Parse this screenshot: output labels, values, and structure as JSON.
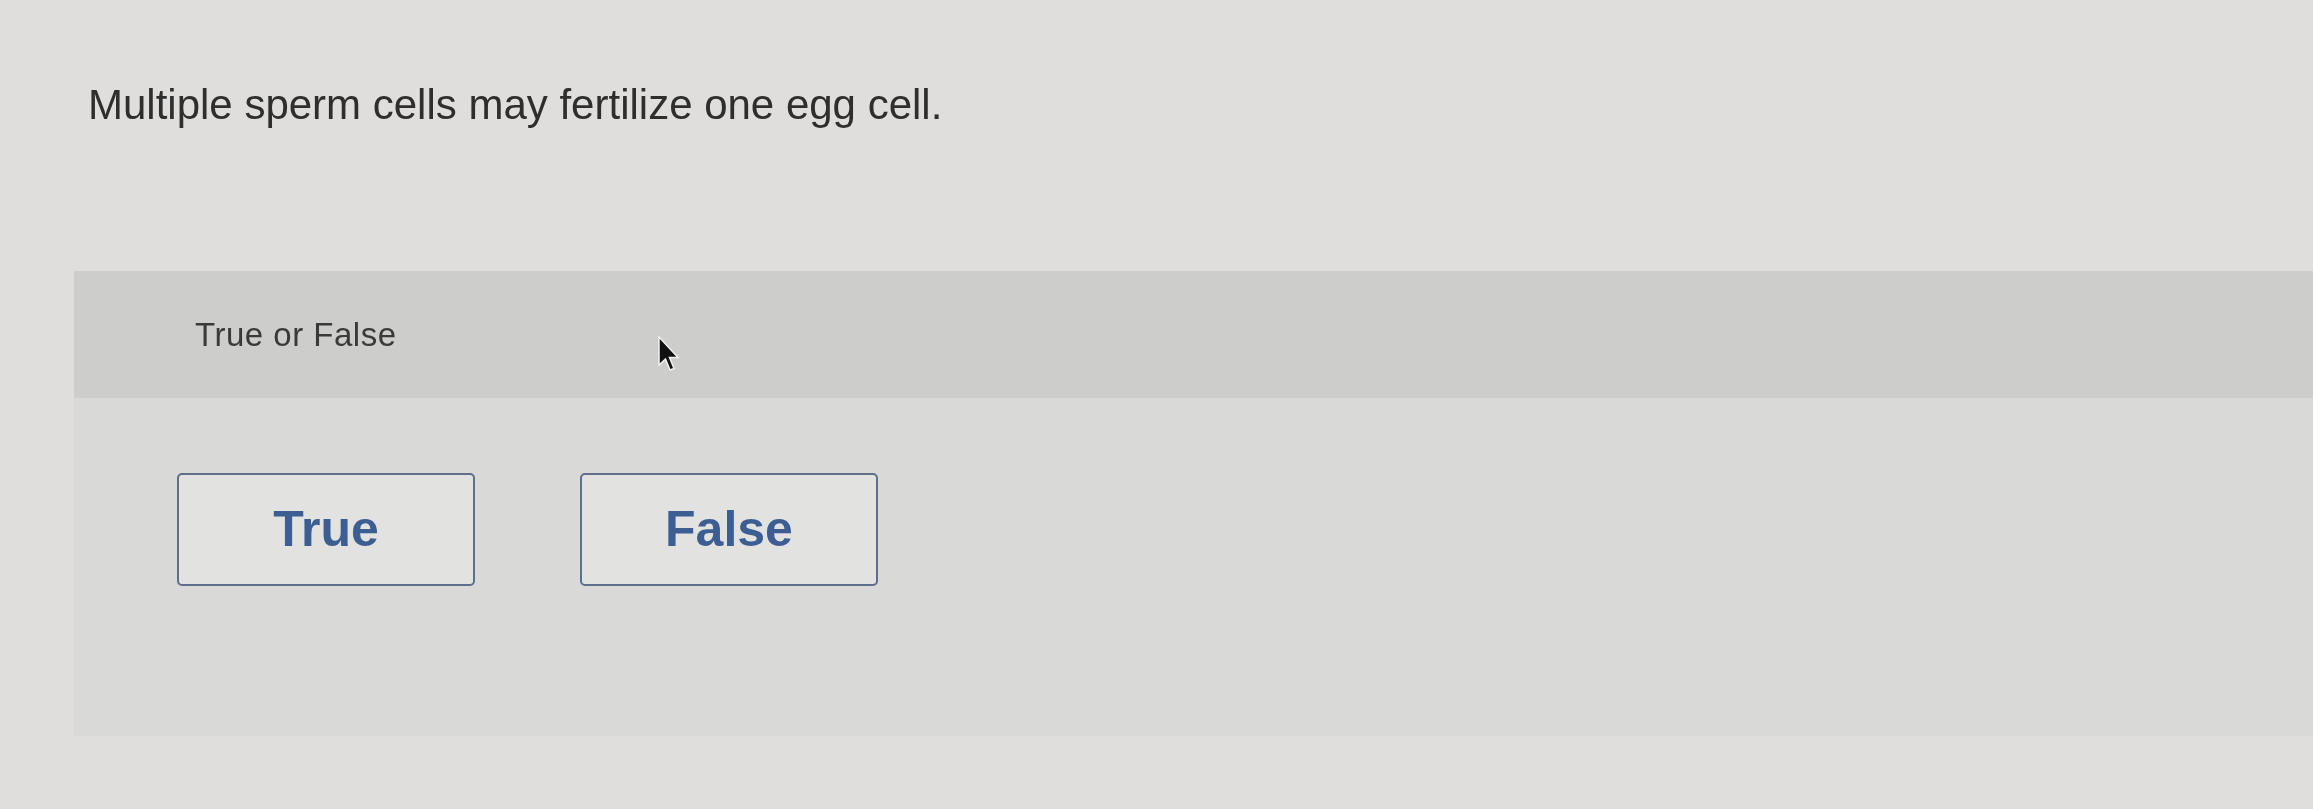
{
  "question": {
    "text": "Multiple sperm cells may fertilize one egg cell."
  },
  "answer_panel": {
    "prompt": "True or False",
    "options": [
      {
        "label": "True",
        "selected": false
      },
      {
        "label": "False",
        "selected": false
      }
    ]
  }
}
